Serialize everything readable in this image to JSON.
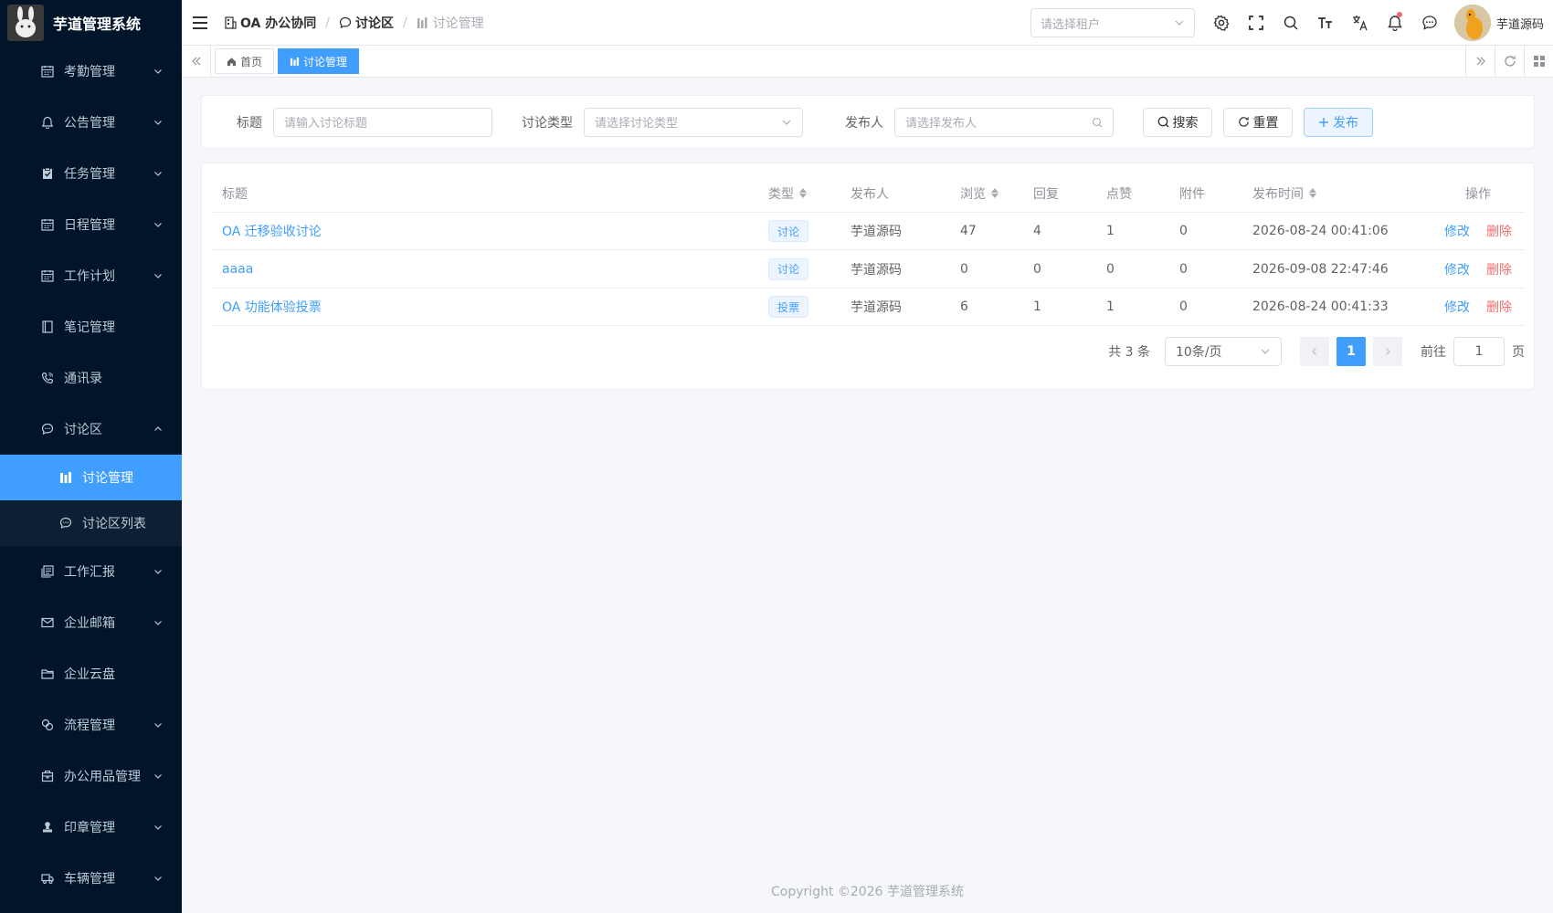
{
  "app": {
    "title": "芋道管理系统"
  },
  "sidebar": {
    "items": [
      {
        "label": "考勤管理",
        "icon": "calendar-icon",
        "arrow": true
      },
      {
        "label": "公告管理",
        "icon": "bell-icon",
        "arrow": true
      },
      {
        "label": "任务管理",
        "icon": "task-icon",
        "arrow": true
      },
      {
        "label": "日程管理",
        "icon": "calendar-icon",
        "arrow": true
      },
      {
        "label": "工作计划",
        "icon": "calendar-icon",
        "arrow": true
      },
      {
        "label": "笔记管理",
        "icon": "notebook-icon",
        "arrow": false
      },
      {
        "label": "通讯录",
        "icon": "phone-icon",
        "arrow": false
      },
      {
        "label": "讨论区",
        "icon": "chat-icon",
        "arrow": true,
        "expanded": true
      },
      {
        "label": "讨论管理",
        "icon": "chart-icon",
        "sub": true,
        "active": true
      },
      {
        "label": "讨论区列表",
        "icon": "chat-icon",
        "sub": true
      },
      {
        "label": "工作汇报",
        "icon": "report-icon",
        "arrow": true
      },
      {
        "label": "企业邮箱",
        "icon": "mail-icon",
        "arrow": true
      },
      {
        "label": "企业云盘",
        "icon": "folder-icon",
        "arrow": false
      },
      {
        "label": "流程管理",
        "icon": "flow-icon",
        "arrow": true
      },
      {
        "label": "办公用品管理",
        "icon": "box-icon",
        "arrow": true
      },
      {
        "label": "印章管理",
        "icon": "stamp-icon",
        "arrow": true
      },
      {
        "label": "车辆管理",
        "icon": "truck-icon",
        "arrow": true
      }
    ]
  },
  "header": {
    "breadcrumb": [
      "OA 办公协同",
      "讨论区",
      "讨论管理"
    ],
    "tenant_placeholder": "请选择租户",
    "user_name": "芋道源码"
  },
  "tags": {
    "home": "首页",
    "current": "讨论管理"
  },
  "search": {
    "title_label": "标题",
    "title_placeholder": "请输入讨论标题",
    "type_label": "讨论类型",
    "type_placeholder": "请选择讨论类型",
    "publisher_label": "发布人",
    "publisher_placeholder": "请选择发布人",
    "search_btn": "搜索",
    "reset_btn": "重置",
    "publish_btn": "发布"
  },
  "table": {
    "columns": [
      "标题",
      "类型",
      "发布人",
      "浏览",
      "回复",
      "点赞",
      "附件",
      "发布时间",
      "操作"
    ],
    "edit_label": "修改",
    "delete_label": "删除",
    "rows": [
      {
        "title": "OA 迁移验收讨论",
        "type": "讨论",
        "publisher": "芋道源码",
        "views": "47",
        "replies": "4",
        "likes": "1",
        "attachments": "0",
        "time": "2026-08-24 00:41:06"
      },
      {
        "title": "aaaa",
        "type": "讨论",
        "publisher": "芋道源码",
        "views": "0",
        "replies": "0",
        "likes": "0",
        "attachments": "0",
        "time": "2026-09-08 22:47:46"
      },
      {
        "title": "OA 功能体验投票",
        "type": "投票",
        "publisher": "芋道源码",
        "views": "6",
        "replies": "1",
        "likes": "1",
        "attachments": "0",
        "time": "2026-08-24 00:41:33"
      }
    ]
  },
  "pagination": {
    "total": "共 3 条",
    "page_size": "10条/页",
    "current": "1",
    "goto_label": "前往",
    "goto_value": "1",
    "page_suffix": "页"
  },
  "footer": {
    "copyright": "Copyright ©2026 芋道管理系统"
  },
  "colors": {
    "sidebar_bg": "#001529",
    "primary": "#409eff",
    "danger": "#f56c6c",
    "active_menu": "#409eff"
  }
}
